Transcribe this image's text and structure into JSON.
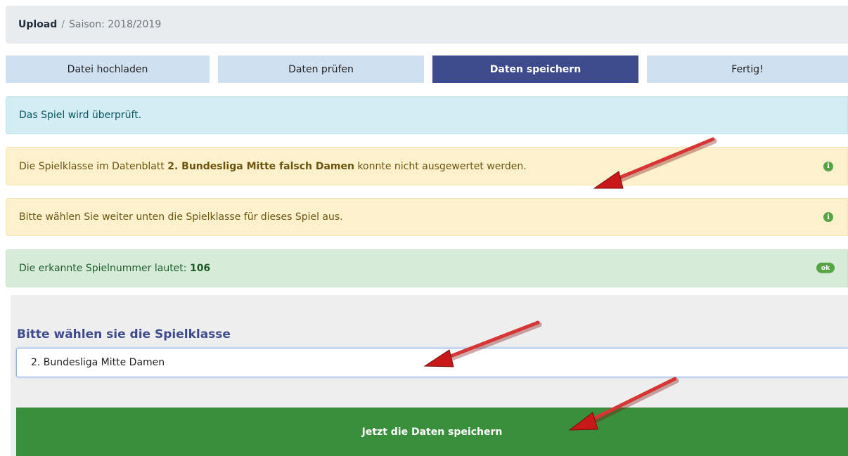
{
  "breadcrumb": {
    "active": "Upload",
    "separator": "/",
    "season": "Saison: 2018/2019"
  },
  "steps": [
    {
      "label": "Datei hochladen",
      "active": false
    },
    {
      "label": "Daten prüfen",
      "active": false
    },
    {
      "label": "Daten speichern",
      "active": true
    },
    {
      "label": "Fertig!",
      "active": false
    }
  ],
  "alerts": {
    "checking": "Das Spiel wird überprüft.",
    "class_error": {
      "prefix": "Die Spielklasse im Datenblatt ",
      "highlight": "2. Bundesliga Mitte falsch Damen",
      "suffix": " konnte nicht ausgewertet werden.",
      "icon": "info-icon"
    },
    "choose_class": {
      "text": "Bitte wählen Sie weiter unten die Spielklasse für dieses Spiel aus.",
      "icon": "info-icon"
    },
    "game_number": {
      "prefix": "Die erkannte Spielnummer lautet: ",
      "number": "106",
      "badge": "ok"
    }
  },
  "form": {
    "label": "Bitte wählen sie die Spielklasse",
    "selected": "2. Bundesliga Mitte Damen",
    "submit_label": "Jetzt die Daten speichern"
  },
  "colors": {
    "active_step": "#3d4a8c",
    "inactive_step": "#cfe0f1",
    "save_button": "#3a8f3c",
    "annotation_arrow": "#d62020"
  },
  "icons": {
    "info": "i",
    "arrow_annotation": "red-arrow-icon"
  }
}
